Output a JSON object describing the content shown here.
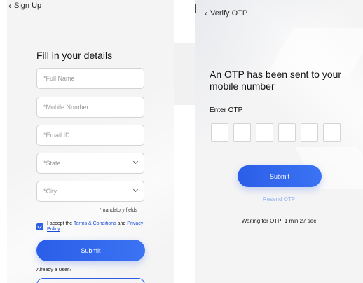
{
  "signup": {
    "back_label": "Sign Up",
    "title": "Fill in your details",
    "fields": [
      {
        "placeholder": "*Full Name",
        "value": ""
      },
      {
        "placeholder": "*Mobile Number",
        "value": ""
      },
      {
        "placeholder": "*Email ID",
        "value": ""
      },
      {
        "placeholder": "*State",
        "value": ""
      },
      {
        "placeholder": "*City",
        "value": ""
      }
    ],
    "mandatory_note": "*mandatory fields",
    "accept": {
      "prefix": "I accept the ",
      "terms_link": "Terms & Conditions",
      "middle": " and ",
      "privacy_link": "Privacy Policy",
      "checked": true
    },
    "submit_label": "Submit",
    "already_user": "Already a User?"
  },
  "otp": {
    "back_label": "Verify OTP",
    "title": "An OTP has been sent to your mobile number",
    "enter_label": "Enter OTP",
    "digits": [
      "",
      "",
      "",
      "",
      "",
      ""
    ],
    "submit_label": "Submit",
    "resend_label": "Resend OTP",
    "waiting_text": "Waiting for OTP: 1 min 27 sec"
  },
  "icons": {
    "back": "chevron-left-icon",
    "dropdown": "chevron-down-icon",
    "checkbox": "checkmark-icon"
  },
  "colors": {
    "accent": "#2b5ee8",
    "link": "#1f4fd8",
    "resend": "#8eb0f2",
    "screen_bg": "#f4f4f5"
  }
}
